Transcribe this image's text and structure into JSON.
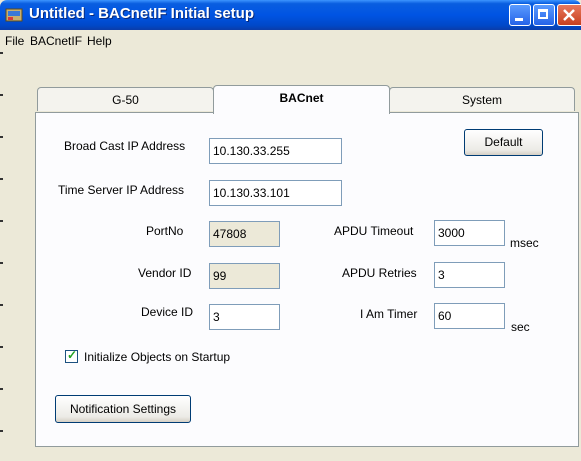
{
  "window": {
    "title": "Untitled - BACnetIF Initial setup",
    "controls": {
      "minimize": "minimize-icon",
      "maximize": "maximize-icon",
      "close": "close-icon"
    }
  },
  "menu": [
    "File",
    "BACnetIF",
    "Help"
  ],
  "tabs": [
    {
      "label": "G-50",
      "active": false
    },
    {
      "label": "BACnet",
      "active": true
    },
    {
      "label": "System",
      "active": false
    }
  ],
  "form": {
    "broadcast_ip": {
      "label": "Broad Cast IP Address",
      "value": "10.130.33.255"
    },
    "time_server_ip": {
      "label": "Time Server IP Address",
      "value": "10.130.33.101"
    },
    "port_no": {
      "label": "PortNo",
      "value": "47808"
    },
    "vendor_id": {
      "label": "Vendor ID",
      "value": "99"
    },
    "device_id": {
      "label": "Device ID",
      "value": "3"
    },
    "apdu_timeout": {
      "label": "APDU Timeout",
      "value": "3000",
      "unit": "msec"
    },
    "apdu_retries": {
      "label": "APDU Retries",
      "value": "3"
    },
    "i_am_timer": {
      "label": "I Am Timer",
      "value": "60",
      "unit": "sec"
    },
    "init_objects": {
      "label": "Initialize Objects on Startup",
      "checked": true
    }
  },
  "buttons": {
    "default": "Default",
    "notification": "Notification Settings"
  },
  "colors": {
    "title_bar": "#0054E3",
    "panel": "#FCFCFE",
    "window_bg": "#ECE9D8"
  }
}
